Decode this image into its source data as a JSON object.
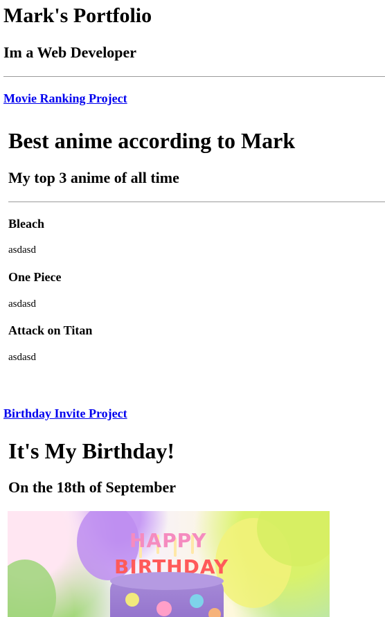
{
  "header": {
    "title": "Mark's Portfolio",
    "subtitle": "Im a Web Developer"
  },
  "movie_project": {
    "link_label": "Movie Ranking Project",
    "title": "Best anime according to Mark",
    "subtitle": "My top 3 anime of all time",
    "items": [
      {
        "name": "Bleach",
        "description": "asdasd"
      },
      {
        "name": "One Piece",
        "description": "asdasd"
      },
      {
        "name": "Attack on Titan",
        "description": "asdasd"
      }
    ]
  },
  "birthday_project": {
    "link_label": "Birthday Invite Project",
    "title": "It's My Birthday!",
    "subtitle": "On the 18th of September",
    "image": {
      "subject": "birthday-cake-image",
      "lettering": [
        "HAPPY",
        "BIRTHDAY"
      ]
    }
  },
  "colors": {
    "link": "#0000ee",
    "rule": "#9a9a9a",
    "cake": "#8e6cc9"
  }
}
